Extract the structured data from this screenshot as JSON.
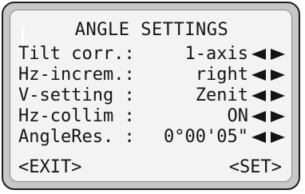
{
  "screen": {
    "title": "ANGLE SETTINGS",
    "rows": [
      {
        "label": "Tilt corr.:",
        "value": "1-axis"
      },
      {
        "label": "Hz-increm.:",
        "value": "right"
      },
      {
        "label": "V-setting :",
        "value": "Zenit"
      },
      {
        "label": "Hz-collim :",
        "value": "ON"
      },
      {
        "label": "AngleRes. :",
        "value": "0°00'05\""
      }
    ],
    "softkeys": {
      "left": "<EXIT>",
      "right": "<SET>"
    }
  },
  "icons": {
    "prev": "arrow-left-icon",
    "next": "arrow-right-icon"
  },
  "colors": {
    "lcd_background": "#f3f3f3",
    "text": "#141414",
    "bezel": "#c7c7c7"
  }
}
